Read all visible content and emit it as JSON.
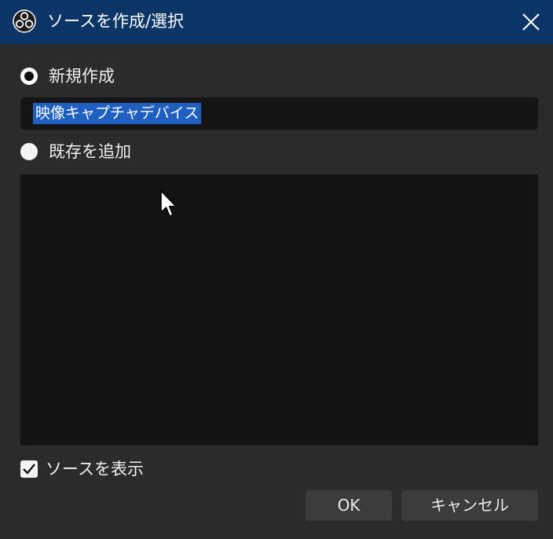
{
  "window": {
    "title": "ソースを作成/選択",
    "app_icon": "obs-logo-icon",
    "close_icon": "close-icon",
    "titlebar_color": "#0b3566"
  },
  "options": {
    "create_new_label": "新規作成",
    "create_new_selected": true,
    "new_name_value": "映像キャプチャデバイス",
    "add_existing_label": "既存を追加",
    "add_existing_selected": false
  },
  "existing_sources": [],
  "show_source": {
    "label": "ソースを表示",
    "checked": true
  },
  "buttons": {
    "ok_label": "OK",
    "cancel_label": "キャンセル"
  }
}
